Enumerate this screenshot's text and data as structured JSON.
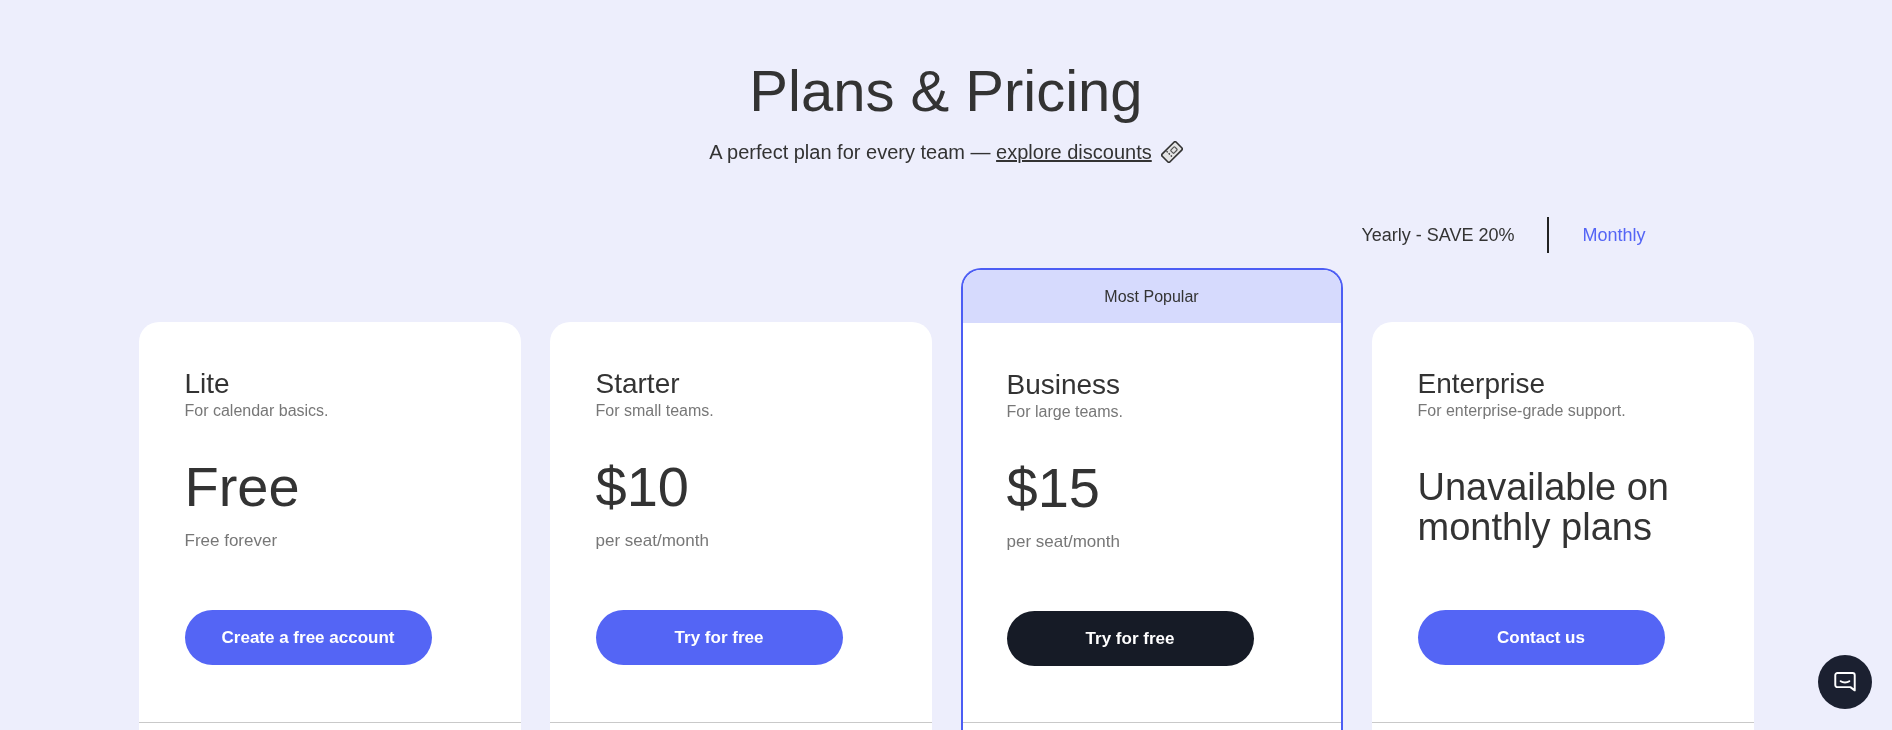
{
  "header": {
    "title": "Plans & Pricing",
    "subtitle": {
      "text": "A perfect plan for every team —",
      "link": "explore discounts"
    }
  },
  "billing_toggle": [
    {
      "label": "Yearly - SAVE 20%",
      "selected": false
    },
    {
      "label": "Monthly",
      "selected": true
    }
  ],
  "plans": [
    {
      "name": "Lite",
      "description": "For calendar basics.",
      "price": {
        "kind": "amount",
        "text": "Free",
        "note": "Free forever"
      },
      "button": "Create a free account",
      "featured": false
    },
    {
      "name": "Starter",
      "description": "For small teams.",
      "price": {
        "kind": "amount",
        "text": "$10",
        "note": "per seat/month"
      },
      "button": "Try for free",
      "featured": false
    },
    {
      "name": "Business",
      "description": "For large teams.",
      "price": {
        "kind": "amount",
        "text": "$15",
        "note": "per seat/month"
      },
      "button": "Try for free",
      "featured": true,
      "badge": "Most Popular"
    },
    {
      "name": "Enterprise",
      "description": "For enterprise-grade support.",
      "price": {
        "kind": "message",
        "text": "Unavailable on monthly plans"
      },
      "button": "Contact us",
      "featured": false
    }
  ]
}
